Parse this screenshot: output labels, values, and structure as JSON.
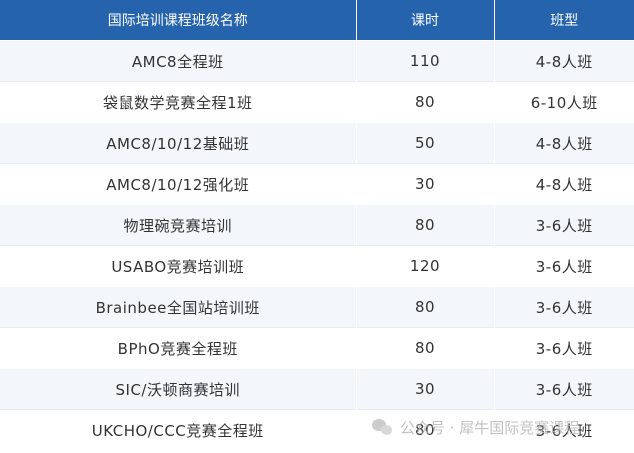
{
  "table": {
    "headers": {
      "name": "国际培训课程班级名称",
      "hours": "课时",
      "class_type": "班型"
    },
    "rows": [
      {
        "name": "AMC8全程班",
        "hours": "110",
        "class_type": "4-8人班"
      },
      {
        "name": "袋鼠数学竞赛全程1班",
        "hours": "80",
        "class_type": "6-10人班"
      },
      {
        "name": "AMC8/10/12基础班",
        "hours": "50",
        "class_type": "4-8人班"
      },
      {
        "name": "AMC8/10/12强化班",
        "hours": "30",
        "class_type": "4-8人班"
      },
      {
        "name": "物理碗竞赛培训",
        "hours": "80",
        "class_type": "3-6人班"
      },
      {
        "name": "USABO竞赛培训班",
        "hours": "120",
        "class_type": "3-6人班"
      },
      {
        "name": "Brainbee全国站培训班",
        "hours": "80",
        "class_type": "3-6人班"
      },
      {
        "name": "BPhO竞赛全程班",
        "hours": "80",
        "class_type": "3-6人班"
      },
      {
        "name": "SIC/沃顿商赛培训",
        "hours": "30",
        "class_type": "3-6人班"
      },
      {
        "name": "UKCHO/CCC竞赛全程班",
        "hours": "80",
        "class_type": "3-6人班"
      }
    ]
  },
  "watermark": {
    "text": "公众号 · 犀牛国际竞赛课程",
    "icon": "wechat-icon"
  },
  "colors": {
    "header_bg": "#2563ad",
    "header_text": "#ffffff",
    "stripe_bg": "#f3f6fb",
    "cell_text": "#333333"
  }
}
